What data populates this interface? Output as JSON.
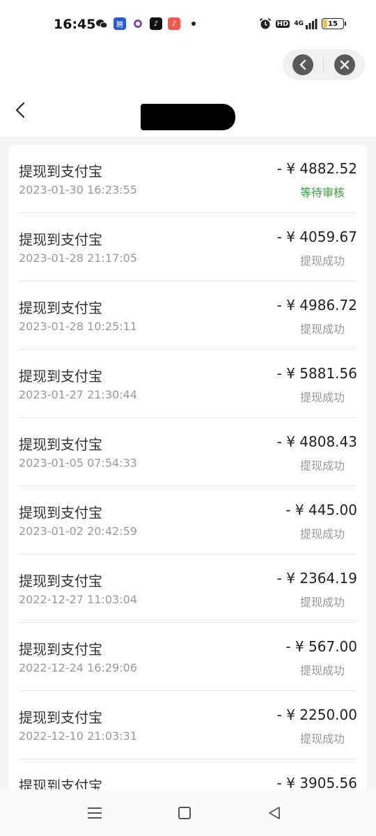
{
  "status_bar": {
    "time": "16:45",
    "battery_level": "15",
    "network": "4G",
    "hd_label": "HD"
  },
  "header": {
    "back_icon": "chevron-left-icon"
  },
  "capsule": {
    "back_icon": "chevron-left-icon",
    "close_icon": "close-icon"
  },
  "records": [
    {
      "title": "提现到支付宝",
      "date": "2023-01-30 16:23:55",
      "amount": "- ¥ 4882.52",
      "status": "等待审核",
      "status_type": "pending"
    },
    {
      "title": "提现到支付宝",
      "date": "2023-01-28 21:17:05",
      "amount": "- ¥ 4059.67",
      "status": "提现成功",
      "status_type": "success"
    },
    {
      "title": "提现到支付宝",
      "date": "2023-01-28 10:25:11",
      "amount": "- ¥ 4986.72",
      "status": "提现成功",
      "status_type": "success"
    },
    {
      "title": "提现到支付宝",
      "date": "2023-01-27 21:30:44",
      "amount": "- ¥ 5881.56",
      "status": "提现成功",
      "status_type": "success"
    },
    {
      "title": "提现到支付宝",
      "date": "2023-01-05 07:54:33",
      "amount": "- ¥ 4808.43",
      "status": "提现成功",
      "status_type": "success"
    },
    {
      "title": "提现到支付宝",
      "date": "2023-01-02 20:42:59",
      "amount": "- ¥ 445.00",
      "status": "提现成功",
      "status_type": "success"
    },
    {
      "title": "提现到支付宝",
      "date": "2022-12-27 11:03:04",
      "amount": "- ¥ 2364.19",
      "status": "提现成功",
      "status_type": "success"
    },
    {
      "title": "提现到支付宝",
      "date": "2022-12-24 16:29:06",
      "amount": "- ¥ 567.00",
      "status": "提现成功",
      "status_type": "success"
    },
    {
      "title": "提现到支付宝",
      "date": "2022-12-10 21:03:31",
      "amount": "- ¥ 2250.00",
      "status": "提现成功",
      "status_type": "success"
    },
    {
      "title": "提现到支付宝",
      "date": "",
      "amount": "- ¥ 3905.56",
      "status": "",
      "status_type": "success"
    }
  ],
  "colors": {
    "pending": "#3a9e3a",
    "muted": "#999999",
    "text": "#333333"
  }
}
